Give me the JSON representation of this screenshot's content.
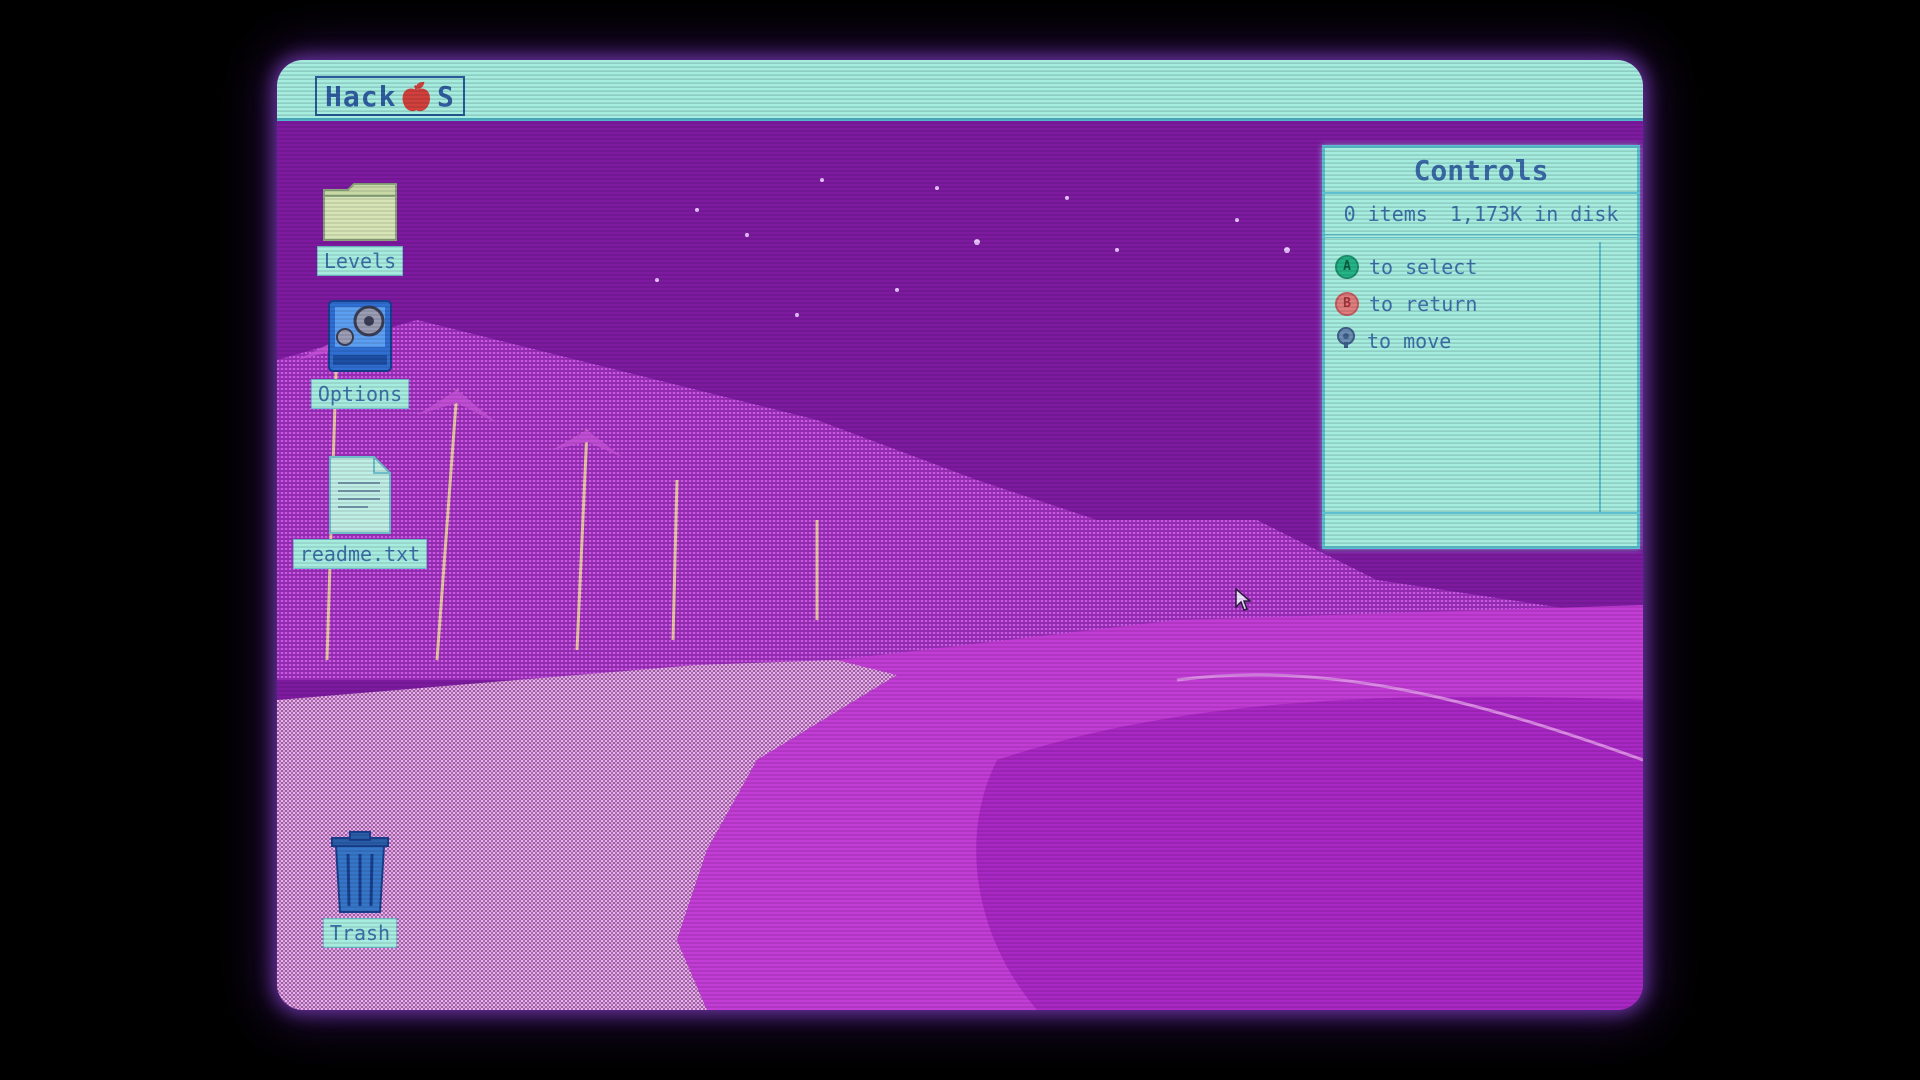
{
  "menubar": {
    "logo_prefix": "Hack",
    "logo_suffix": "S",
    "logo_icon": "apple-logo-icon"
  },
  "desktop": {
    "icons": [
      {
        "label": "Levels",
        "icon": "folder-icon"
      },
      {
        "label": "Options",
        "icon": "settings-app-icon"
      },
      {
        "label": "readme.txt",
        "icon": "text-file-icon"
      },
      {
        "label": "Trash",
        "icon": "trash-icon"
      }
    ]
  },
  "controls_window": {
    "title": "Controls",
    "item_count": "0 items",
    "disk_info": "1,173K in disk",
    "rows": [
      {
        "button": "A",
        "icon": "a-button-icon",
        "text": "to select"
      },
      {
        "button": "B",
        "icon": "b-button-icon",
        "text": "to return"
      },
      {
        "icon": "joystick-icon",
        "text": "to move"
      }
    ]
  },
  "colors": {
    "sky": "#7d1aa0",
    "panel": "#a6ecdf",
    "panel_text": "#3d6fa9",
    "beach": "#c98fd3",
    "sea": "#c23cd6"
  }
}
